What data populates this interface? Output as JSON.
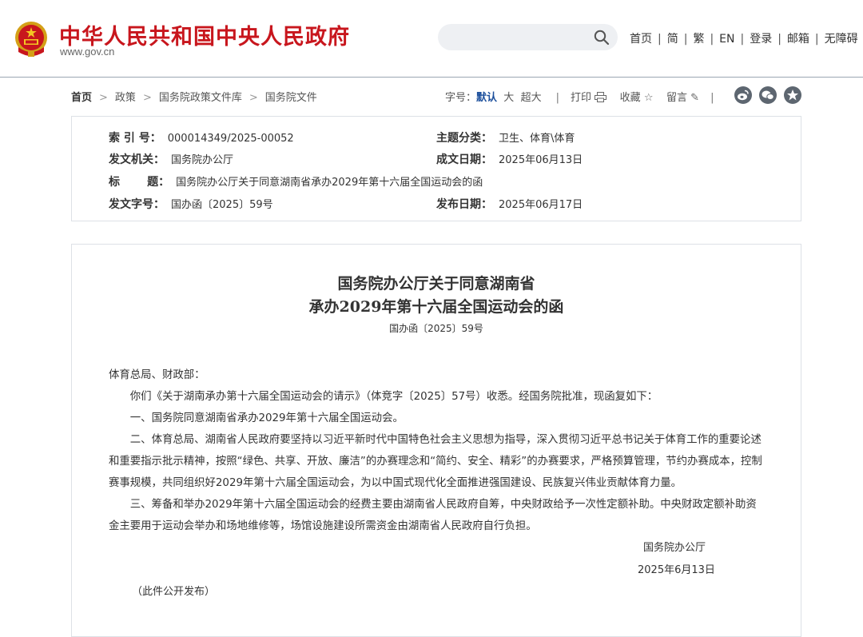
{
  "header": {
    "site_title": "中华人民共和国中央人民政府",
    "site_url": "www.gov.cn",
    "search_placeholder": "",
    "nav": [
      "首页",
      "简",
      "繁",
      "EN",
      "登录",
      "邮箱",
      "无障碍"
    ]
  },
  "breadcrumb": [
    "首页",
    "政策",
    "国务院政策文件库",
    "国务院文件"
  ],
  "tools": {
    "font_size_label": "字号：",
    "font_default": "默认",
    "font_large": "大",
    "font_xlarge": "超大",
    "print": "打印",
    "favorite": "收藏",
    "comment": "留言"
  },
  "meta": {
    "index_label": "索  引  号：",
    "index_value": "000014349/2025-00052",
    "category_label": "主题分类：",
    "category_value": "卫生、体育\\体育",
    "issuer_label": "发文机关：",
    "issuer_value": "国务院办公厅",
    "written_label": "成文日期：",
    "written_value": "2025年06月13日",
    "title_label": "标       题：",
    "title_value": "国务院办公厅关于同意湖南省承办2029年第十六届全国运动会的函",
    "docno_label": "发文字号：",
    "docno_value": "国办函〔2025〕59号",
    "published_label": "发布日期：",
    "published_value": "2025年06月17日"
  },
  "document": {
    "title_line1": "国务院办公厅关于同意湖南省",
    "title_line2": "承办2029年第十六届全国运动会的函",
    "doc_number": "国办函〔2025〕59号",
    "salutation": "体育总局、财政部：",
    "paragraphs": [
      "你们《关于湖南承办第十六届全国运动会的请示》（体竞字〔2025〕57号）收悉。经国务院批准，现函复如下：",
      "一、国务院同意湖南省承办2029年第十六届全国运动会。",
      "二、体育总局、湖南省人民政府要坚持以习近平新时代中国特色社会主义思想为指导，深入贯彻习近平总书记关于体育工作的重要论述和重要指示批示精神，按照“绿色、共享、开放、廉洁”的办赛理念和“简约、安全、精彩”的办赛要求，严格预算管理，节约办赛成本，控制赛事规模，共同组织好2029年第十六届全国运动会，为以中国式现代化全面推进强国建设、民族复兴伟业贡献体育力量。",
      "三、筹备和举办2029年第十六届全国运动会的经费主要由湖南省人民政府自筹，中央财政给予一次性定额补助。中央财政定额补助资金主要用于运动会举办和场地维修等，场馆设施建设所需资金由湖南省人民政府自行负担。"
    ],
    "signatory": "国务院办公厅",
    "sign_date": "2025年6月13日",
    "publish_note": "（此件公开发布）"
  },
  "colors": {
    "brand_red": "#c8161d",
    "accent_blue": "#1c4f9c",
    "icon_gray": "#5d6670"
  }
}
